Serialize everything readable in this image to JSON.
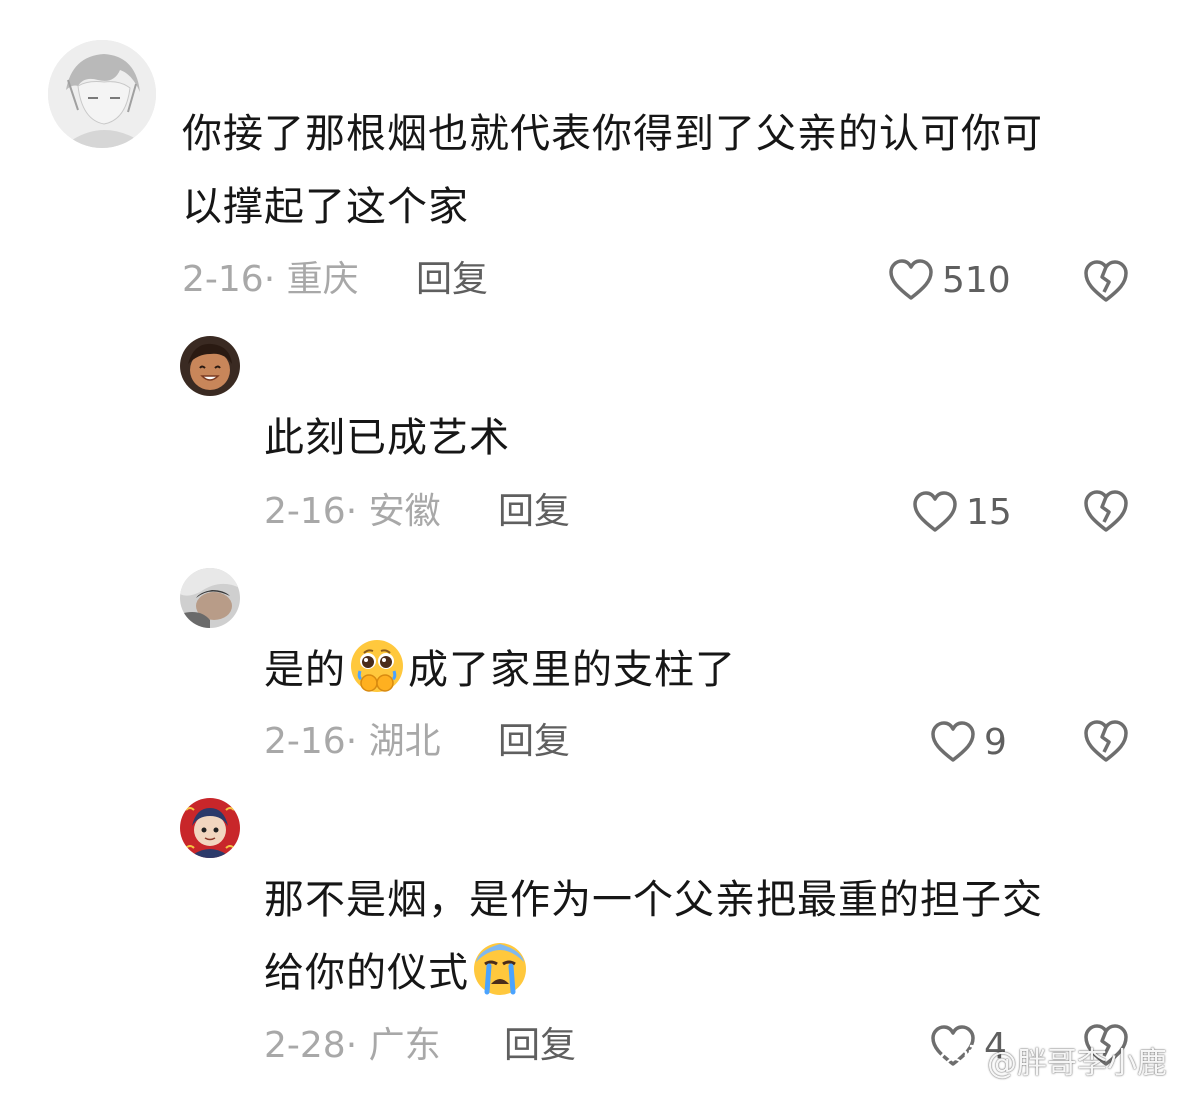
{
  "comments": [
    {
      "text_lines": [
        "你接了那根烟也就代表你得到了父亲的认可你可",
        "以撑起了这个家"
      ],
      "date_location": "2-16· 重庆",
      "reply_label": "回复",
      "likes": "510"
    },
    {
      "text_lines": [
        "此刻已成艺术"
      ],
      "date_location": "2-16· 安徽",
      "reply_label": "回复",
      "likes": "15"
    },
    {
      "text_before_emoji": "是的",
      "text_after_emoji": "成了家里的支柱了",
      "emoji": "pleading-face-holding-back-tears-icon",
      "date_location": "2-16· 湖北",
      "reply_label": "回复",
      "likes": "9"
    },
    {
      "text_line1": "那不是烟，是作为一个父亲把最重的担子交",
      "text_line2": "给你的仪式",
      "emoji": "crying-face-icon",
      "date_location": "2-28· 广东",
      "reply_label": "回复",
      "likes": "4"
    }
  ],
  "watermark": {
    "text": "@胖哥李小鹿",
    "icon": "weibo-logo-icon"
  },
  "colors": {
    "text": "#161616",
    "meta": "#a8a8a8",
    "reply": "#5f5f5f",
    "icon": "#6e6e6e"
  }
}
